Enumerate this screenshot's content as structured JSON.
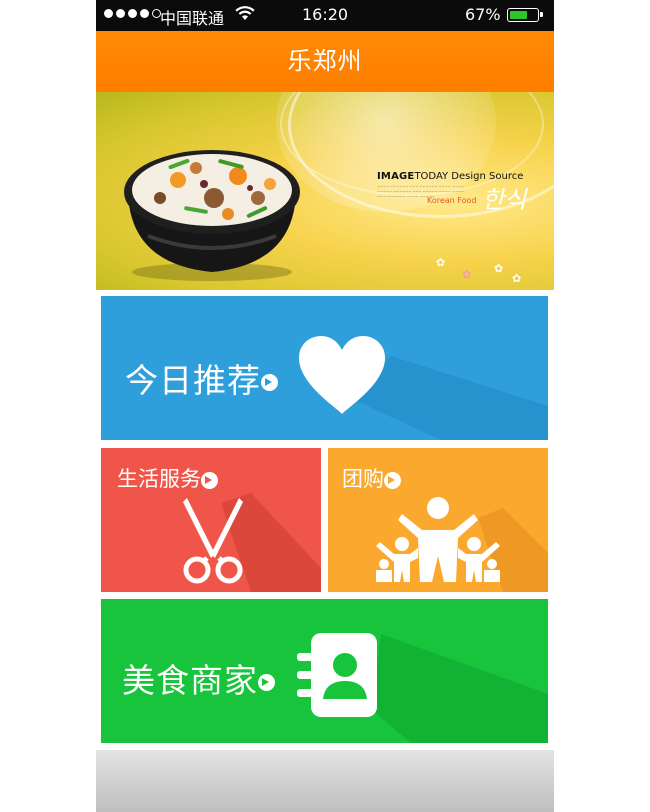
{
  "status_bar": {
    "carrier": "中国联通",
    "time": "16:20",
    "battery_percent": "67%",
    "battery_level": 0.67,
    "signal_bars_filled": 4,
    "signal_bars_total": 5
  },
  "header": {
    "title": "乐郑州"
  },
  "banner": {
    "ad_title_bold": "IMAGE",
    "ad_title_rest": "TODAY Design Source",
    "ad_subtitle": "Korean Food",
    "ad_handwriting": "한식"
  },
  "tiles": {
    "recommend": {
      "label": "今日推荐",
      "color": "#2f9fdc",
      "icon": "heart-icon"
    },
    "life_service": {
      "label": "生活服务",
      "color": "#f0554a",
      "icon": "scissors-icon"
    },
    "group_buy": {
      "label": "团购",
      "color": "#fba82e",
      "icon": "people-group-icon"
    },
    "food_merchants": {
      "label": "美食商家",
      "color": "#17c43b",
      "icon": "contact-book-icon"
    }
  },
  "colors": {
    "header": "#ff8000",
    "status_bar": "#0b0b0b",
    "battery": "#2ec52c"
  }
}
